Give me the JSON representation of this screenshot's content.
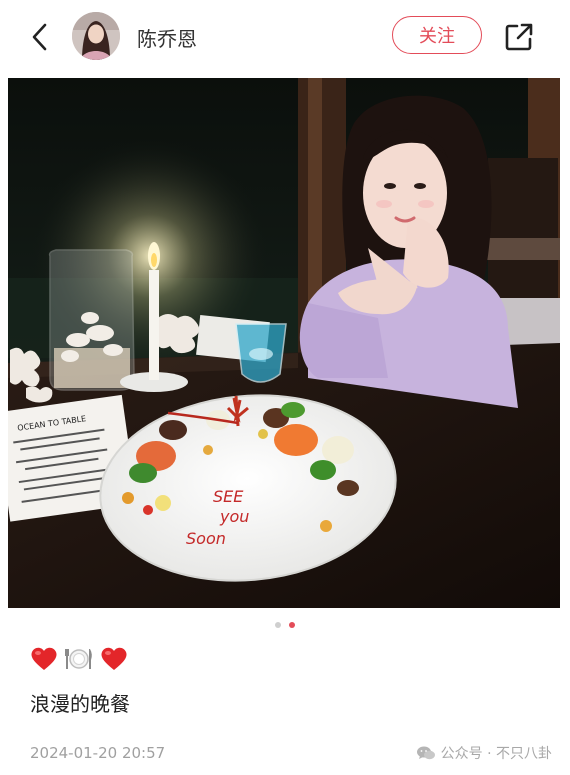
{
  "header": {
    "username": "陈乔恩",
    "follow_label": "关注"
  },
  "photo": {
    "plate_text": [
      "SEE",
      "you",
      "Soon"
    ],
    "menu_title": "OCEAN TO TABLE"
  },
  "carousel": {
    "total": 2,
    "active_index": 1
  },
  "post": {
    "emoji_line": "❤️🍽️❤️",
    "caption": "浪漫的晚餐",
    "timestamp": "2024-01-20 20:57"
  },
  "watermark": {
    "text": "公众号 · 不只八卦"
  },
  "colors": {
    "accent": "#e34c59",
    "timestamp": "#a0a0a0"
  },
  "icons": {
    "back": "chevron-left-icon",
    "share": "share-external-icon",
    "watermark": "wechat-icon"
  }
}
